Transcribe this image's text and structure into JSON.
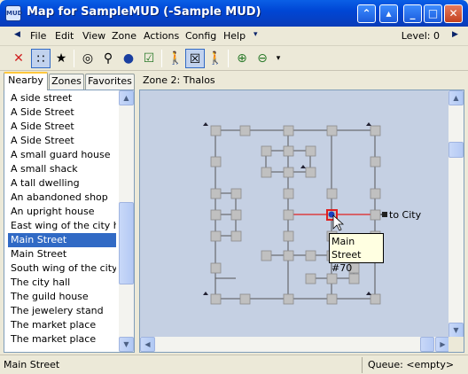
{
  "window": {
    "title": "Map for SampleMUD (-Sample MUD)",
    "app_icon_text": "MUD",
    "buttons": [
      "restore-up",
      "pin",
      "minimize",
      "maximize",
      "close"
    ]
  },
  "menu": {
    "items": [
      "File",
      "Edit",
      "View",
      "Zone",
      "Actions",
      "Config",
      "Help"
    ],
    "level_label": "Level: 0"
  },
  "toolbar": {
    "tools": [
      "delete-icon",
      "grid-dots-icon",
      "wand-icon",
      "binoculars-icon",
      "magnifier-icon",
      "search-globe-icon",
      "checkbox-icon",
      "walk-list-icon",
      "walk-path-icon",
      "walk-icon",
      "zoom-in-icon",
      "zoom-out-icon"
    ]
  },
  "left": {
    "tabs": [
      "Nearby",
      "Zones",
      "Favorites"
    ],
    "items": [
      "A side street",
      "A Side Street",
      "A Side Street",
      "A Side Street",
      "A small guard house",
      "A small shack",
      "A tall dwelling",
      "An abandoned shop",
      "An upright house",
      "East wing of the city hall",
      "Main Street",
      "Main Street",
      "South wing of the city ha",
      "The city hall",
      "The guild house",
      "The jewelery stand",
      "The market place",
      "The market place"
    ],
    "selected_index": 10
  },
  "map": {
    "zone_title": "Zone 2: Thalos",
    "exit_label": "to City",
    "tooltip_line1": "Main Street",
    "tooltip_line2": "#70",
    "background": "#c5d0e3",
    "highlight_color": "#e02020",
    "room_color": "#c0c0c0"
  },
  "status": {
    "left": "Main Street",
    "queue": "Queue: <empty>"
  }
}
